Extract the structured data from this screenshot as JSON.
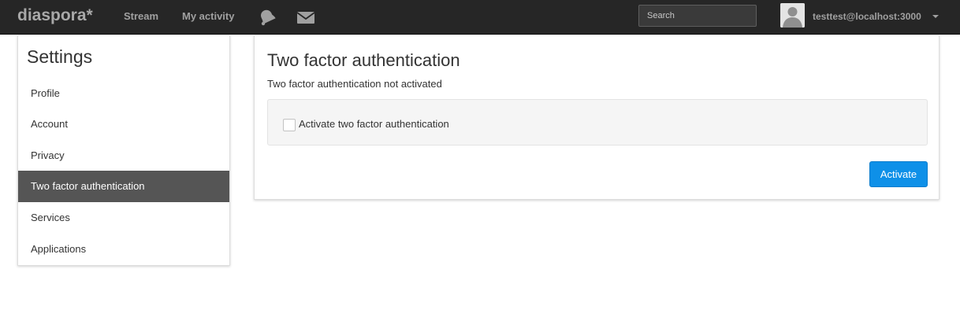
{
  "navbar": {
    "brand": "diaspora*",
    "links": {
      "stream": "Stream",
      "my_activity": "My activity"
    },
    "icons": {
      "notifications": "bell-icon",
      "conversations": "envelope-icon"
    },
    "search": {
      "placeholder": "Search",
      "value": ""
    },
    "user": {
      "name": "testtest@localhost:3000"
    }
  },
  "sidebar": {
    "title": "Settings",
    "items": [
      {
        "label": "Profile",
        "active": false
      },
      {
        "label": "Account",
        "active": false
      },
      {
        "label": "Privacy",
        "active": false
      },
      {
        "label": "Two factor authentication",
        "active": true
      },
      {
        "label": "Services",
        "active": false
      },
      {
        "label": "Applications",
        "active": false
      }
    ]
  },
  "main": {
    "title": "Two factor authentication",
    "status": "Two factor authentication not activated",
    "checkbox_label": "Activate two factor authentication",
    "checkbox_checked": false,
    "activate_button": "Activate"
  },
  "colors": {
    "navbar_bg": "#262626",
    "accent": "#0e90e8",
    "active_item_bg": "#555555",
    "well_bg": "#f5f5f5"
  }
}
